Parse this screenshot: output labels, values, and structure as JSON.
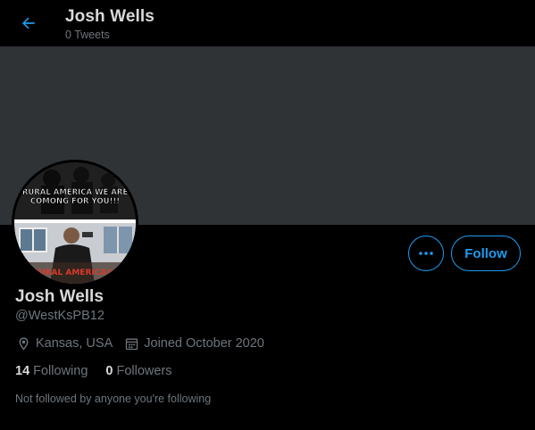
{
  "header": {
    "name": "Josh Wells",
    "tweet_count": "0 Tweets"
  },
  "avatar": {
    "caption_top": "RURAL AMERICA WE ARE COMONG FOR YOU!!!",
    "caption_top_line1": "RURAL AMERICA WE ARE",
    "caption_top_line2": "COMONG FOR YOU!!!",
    "caption_bottom": "RURAL AMERICA!!!"
  },
  "actions": {
    "more_label": "•••",
    "follow_label": "Follow"
  },
  "profile": {
    "name": "Josh Wells",
    "handle": "@WestKsPB12",
    "location": "Kansas, USA",
    "joined": "Joined October 2020"
  },
  "stats": {
    "following_count": "14",
    "following_label": "Following",
    "followers_count": "0",
    "followers_label": "Followers"
  },
  "social_context": "Not followed by anyone you're following",
  "colors": {
    "accent": "#1d9bf0",
    "banner": "#2f3336",
    "background": "#000000"
  },
  "icons": [
    "arrow-left-icon",
    "location-pin-icon",
    "calendar-icon",
    "more-horizontal-icon"
  ]
}
